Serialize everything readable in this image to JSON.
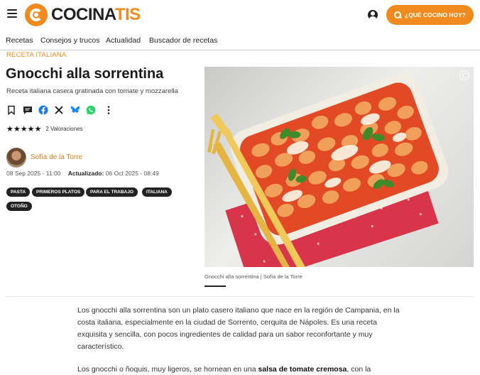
{
  "header": {
    "logo_prefix": "COCINA",
    "logo_suffix": "TIS",
    "cta_label": "¿QUÉ COCINO HOY?",
    "brand_color": "#f08a1e"
  },
  "nav": {
    "items": [
      "Recetas",
      "Consejos y trucos",
      "Actualidad",
      "Buscador de recetas"
    ]
  },
  "article": {
    "eyebrow": "RECETA ITALIANA",
    "title": "Gnocchi alla sorrentina",
    "subtitle": "Receta italiana casera gratinada con tomate y mozzarella",
    "share_icons": [
      "bookmark-icon",
      "comment-icon",
      "facebook-icon",
      "x-icon",
      "bluesky-icon",
      "whatsapp-icon",
      "more-icon"
    ],
    "rating": {
      "stars": "★★★★★",
      "value": 5,
      "count_label": "2 Valoraciones"
    },
    "author": "Sofía de la Torre",
    "published": "08 Sep 2025 - 11:00",
    "updated_label": "Actualizado:",
    "updated": "06 Oct 2025 - 08:49",
    "tags": [
      "PASTA",
      "PRIMEROS PLATOS",
      "PARA EL TRABAJO",
      "ITALIANA",
      "OTOÑO"
    ],
    "image_caption_title": "Gnocchi alla sorrentina",
    "image_caption_separator": " | ",
    "image_caption_author": "Sofía de la Torre",
    "body": {
      "p1": "Los gnocchi alla sorrentina son un plato casero italiano que nace en la región de Campania, en la costa italiana, especialmente en la ciudad de Sorrento, cerquita de Nápoles. Es una receta exquisita y sencilla, con pocos ingredientes de calidad para un sabor reconfortante y muy característico.",
      "p2_before": "Los gnocchi o ñoquis, muy ligeros, se hornean en una ",
      "p2_bold": "salsa de tomate cremosa",
      "p2_after": ", con la"
    }
  }
}
